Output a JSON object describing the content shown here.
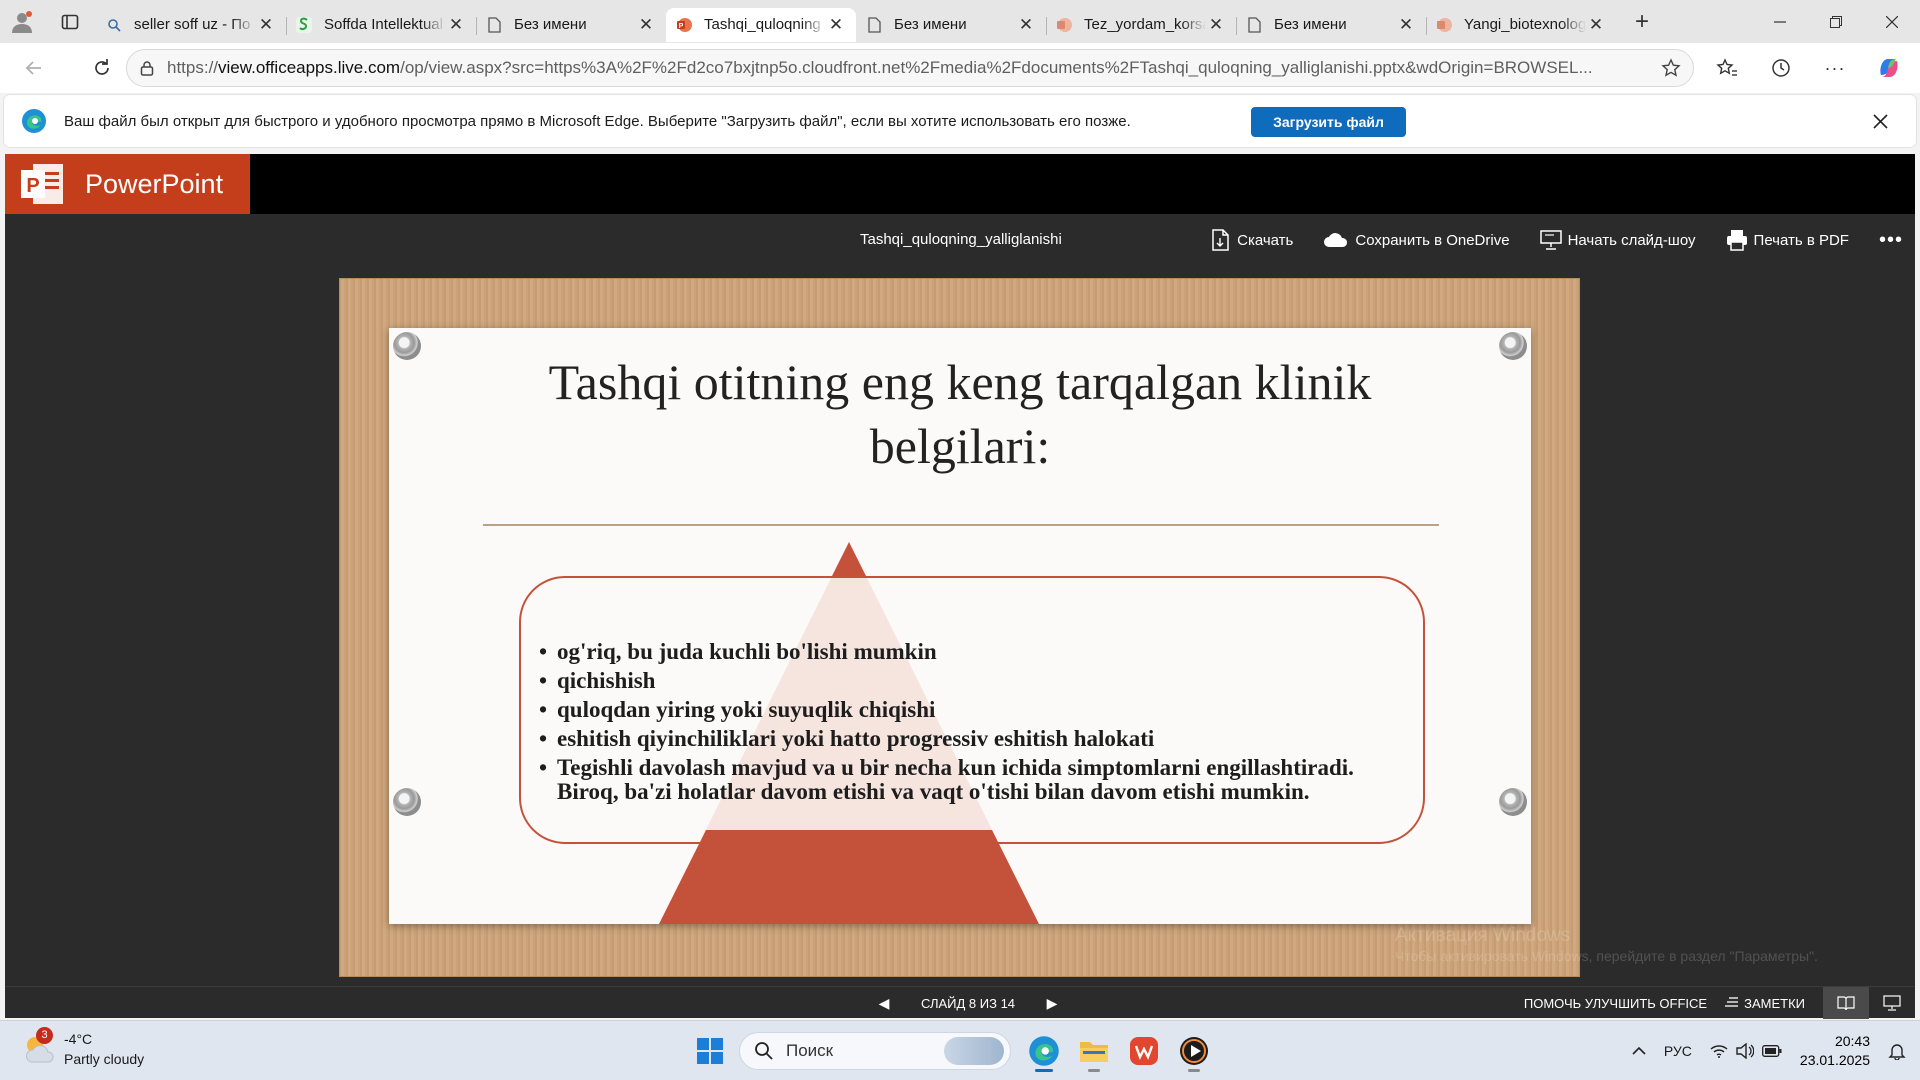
{
  "browser": {
    "tabs": [
      {
        "title": "seller soff uz - По",
        "favicon": "search-favicon",
        "active": false
      },
      {
        "title": "Soffda Intellektual",
        "favicon": "soffda-favicon",
        "active": false
      },
      {
        "title": "Без имени",
        "favicon": "blank-page-favicon",
        "active": false
      },
      {
        "title": "Tashqi_quloqning",
        "favicon": "powerpoint-favicon",
        "active": true
      },
      {
        "title": "Без имени",
        "favicon": "blank-page-favicon",
        "active": false
      },
      {
        "title": "Tez_yordam_korsa",
        "favicon": "powerpoint-favicon",
        "active": false
      },
      {
        "title": "Без имени",
        "favicon": "blank-page-favicon",
        "active": false
      },
      {
        "title": "Yangi_biotexnolog",
        "favicon": "powerpoint-favicon",
        "active": false
      }
    ],
    "url_prefix": "https://",
    "url_host": "view.officeapps.live.com",
    "url_rest": "/op/view.aspx?src=https%3A%2F%2Fd2co7bxjtnp5o.cloudfront.net%2Fmedia%2Fdocuments%2FTashqi_quloqning_yalliglanishi.pptx&wdOrigin=BROWSEL...",
    "infobar": {
      "message": "Ваш файл был открыт для быстрого и удобного просмотра прямо в Microsoft Edge. Выберите \"Загрузить файл\", если вы хотите использовать его позже.",
      "button": "Загрузить файл"
    }
  },
  "ppt": {
    "brand": "PowerPoint",
    "doc_title": "Tashqi_quloqning_yalliglanishi",
    "actions": {
      "download": "Скачать",
      "onedrive": "Сохранить в OneDrive",
      "slideshow": "Начать слайд-шоу",
      "print": "Печать в PDF"
    },
    "slide": {
      "title": "Tashqi otitning eng keng tarqalgan klinik belgilari:",
      "bullets": [
        "og'riq, bu juda kuchli bo'lishi mumkin",
        "qichishish",
        "quloqdan yiring yoki suyuqlik chiqishi",
        "eshitish qiyinchiliklari yoki hatto progressiv eshitish halokati",
        "Tegishli davolash mavjud va u bir necha kun ichida simptomlarni engillashtiradi. Biroq, ba'zi holatlar davom etishi va vaqt o'tishi bilan davom etishi mumkin."
      ],
      "accent_color": "#c4523a"
    },
    "watermark_line1": "Активация Windows",
    "watermark_line2": "Чтобы активировать Windows, перейдите в раздел \"Параметры\".",
    "status": {
      "slide_counter": "СЛАЙД 8 ИЗ 14",
      "help": "ПОМОЧЬ УЛУЧШИТЬ OFFICE",
      "notes": "ЗАМЕТКИ"
    }
  },
  "taskbar": {
    "weather_badge": "3",
    "temperature": "-4°C",
    "weather_desc": "Partly cloudy",
    "search_placeholder": "Поиск",
    "lang": "РУС",
    "time": "20:43",
    "date": "23.01.2025"
  }
}
